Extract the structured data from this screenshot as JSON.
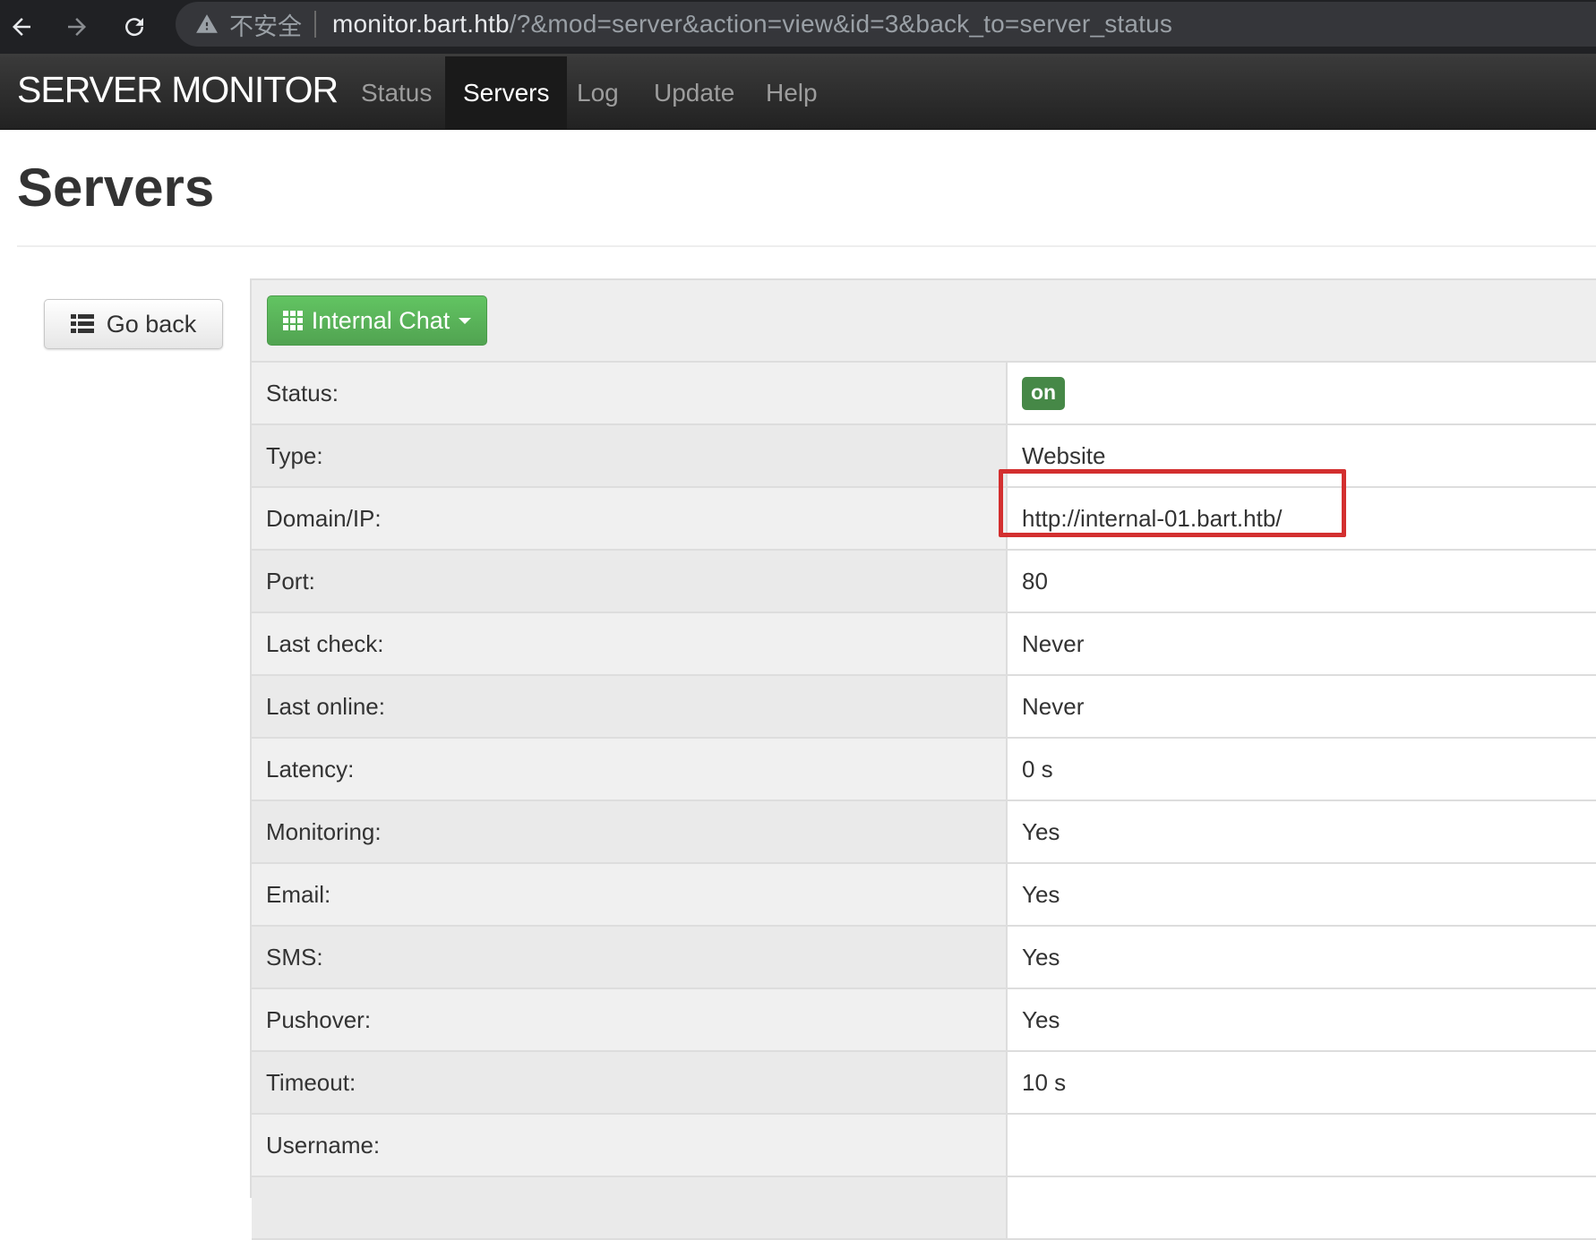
{
  "browser": {
    "not_secure": "不安全",
    "url_host": "monitor.bart.htb",
    "url_rest": "/?&mod=server&action=view&id=3&back_to=server_status"
  },
  "navbar": {
    "brand": "SERVER MONITOR",
    "items": [
      {
        "label": "Status",
        "active": false
      },
      {
        "label": "Servers",
        "active": true
      },
      {
        "label": "Log",
        "active": false
      },
      {
        "label": "Update",
        "active": false
      },
      {
        "label": "Help",
        "active": false
      }
    ]
  },
  "page": {
    "title": "Servers",
    "go_back_label": "Go back",
    "server_dropdown_label": "Internal Chat"
  },
  "details": [
    {
      "label": "Status:",
      "value": "on"
    },
    {
      "label": "Type:",
      "value": "Website"
    },
    {
      "label": "Domain/IP:",
      "value": "http://internal-01.bart.htb/"
    },
    {
      "label": "Port:",
      "value": "80"
    },
    {
      "label": "Last check:",
      "value": "Never"
    },
    {
      "label": "Last online:",
      "value": "Never"
    },
    {
      "label": "Latency:",
      "value": "0 s"
    },
    {
      "label": "Monitoring:",
      "value": "Yes"
    },
    {
      "label": "Email:",
      "value": "Yes"
    },
    {
      "label": "SMS:",
      "value": "Yes"
    },
    {
      "label": "Pushover:",
      "value": "Yes"
    },
    {
      "label": "Timeout:",
      "value": "10 s"
    },
    {
      "label": "Username:",
      "value": ""
    }
  ],
  "colors": {
    "status_on": "#468847",
    "dropdown_green": "#51a351",
    "highlight_red": "#d32f2f"
  }
}
